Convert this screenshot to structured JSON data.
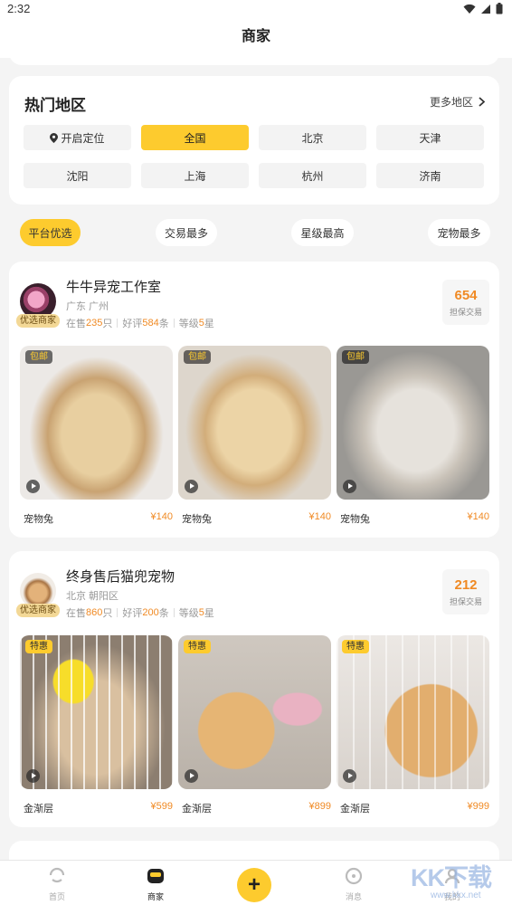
{
  "status_bar": {
    "time": "2:32"
  },
  "header": {
    "title": "商家"
  },
  "regions": {
    "title": "热门地区",
    "more_label": "更多地区",
    "items": [
      {
        "label": "开启定位",
        "icon": "location-pin-icon",
        "active": false
      },
      {
        "label": "全国",
        "active": true
      },
      {
        "label": "北京",
        "active": false
      },
      {
        "label": "天津",
        "active": false
      },
      {
        "label": "沈阳",
        "active": false
      },
      {
        "label": "上海",
        "active": false
      },
      {
        "label": "杭州",
        "active": false
      },
      {
        "label": "济南",
        "active": false
      }
    ]
  },
  "sort_tabs": [
    {
      "label": "平台优选",
      "active": true
    },
    {
      "label": "交易最多",
      "active": false
    },
    {
      "label": "星级最高",
      "active": false
    },
    {
      "label": "宠物最多",
      "active": false
    }
  ],
  "shops": [
    {
      "name": "牛牛异宠工作室",
      "badge": "优选商家",
      "location": "广东 广州",
      "stats": {
        "on_sale_prefix": "在售",
        "on_sale": "235",
        "on_sale_unit": "只",
        "reviews_prefix": "好评",
        "reviews": "584",
        "reviews_unit": "条",
        "level_prefix": "等级",
        "level": "5",
        "level_unit": "星"
      },
      "trade_count": "654",
      "trade_label": "担保交易",
      "products": [
        {
          "tag": "包邮",
          "name": "宠物兔",
          "price": "¥140"
        },
        {
          "tag": "包邮",
          "name": "宠物兔",
          "price": "¥140"
        },
        {
          "tag": "包邮",
          "name": "宠物兔",
          "price": "¥140"
        }
      ]
    },
    {
      "name": "终身售后猫兜宠物",
      "badge": "优选商家",
      "location": "北京 朝阳区",
      "stats": {
        "on_sale_prefix": "在售",
        "on_sale": "860",
        "on_sale_unit": "只",
        "reviews_prefix": "好评",
        "reviews": "200",
        "reviews_unit": "条",
        "level_prefix": "等级",
        "level": "5",
        "level_unit": "星"
      },
      "trade_count": "212",
      "trade_label": "担保交易",
      "products": [
        {
          "tag": "特惠",
          "name": "金渐层",
          "price": "¥599"
        },
        {
          "tag": "特惠",
          "name": "金渐层",
          "price": "¥899"
        },
        {
          "tag": "特惠",
          "name": "金渐层",
          "price": "¥999"
        }
      ]
    }
  ],
  "bottom_nav": [
    {
      "label": "首页",
      "icon": "home-icon",
      "active": false
    },
    {
      "label": "商家",
      "icon": "shop-icon",
      "active": true
    },
    {
      "label": "",
      "icon": "add-icon",
      "active": false
    },
    {
      "label": "消息",
      "icon": "message-icon",
      "active": false
    },
    {
      "label": "我的",
      "icon": "profile-icon",
      "active": false
    }
  ],
  "watermark": {
    "text": "KK下载",
    "url": "www.kkx.net"
  },
  "colors": {
    "accent": "#fdcb2e",
    "price": "#f08a24",
    "background": "#f4f4f4"
  }
}
